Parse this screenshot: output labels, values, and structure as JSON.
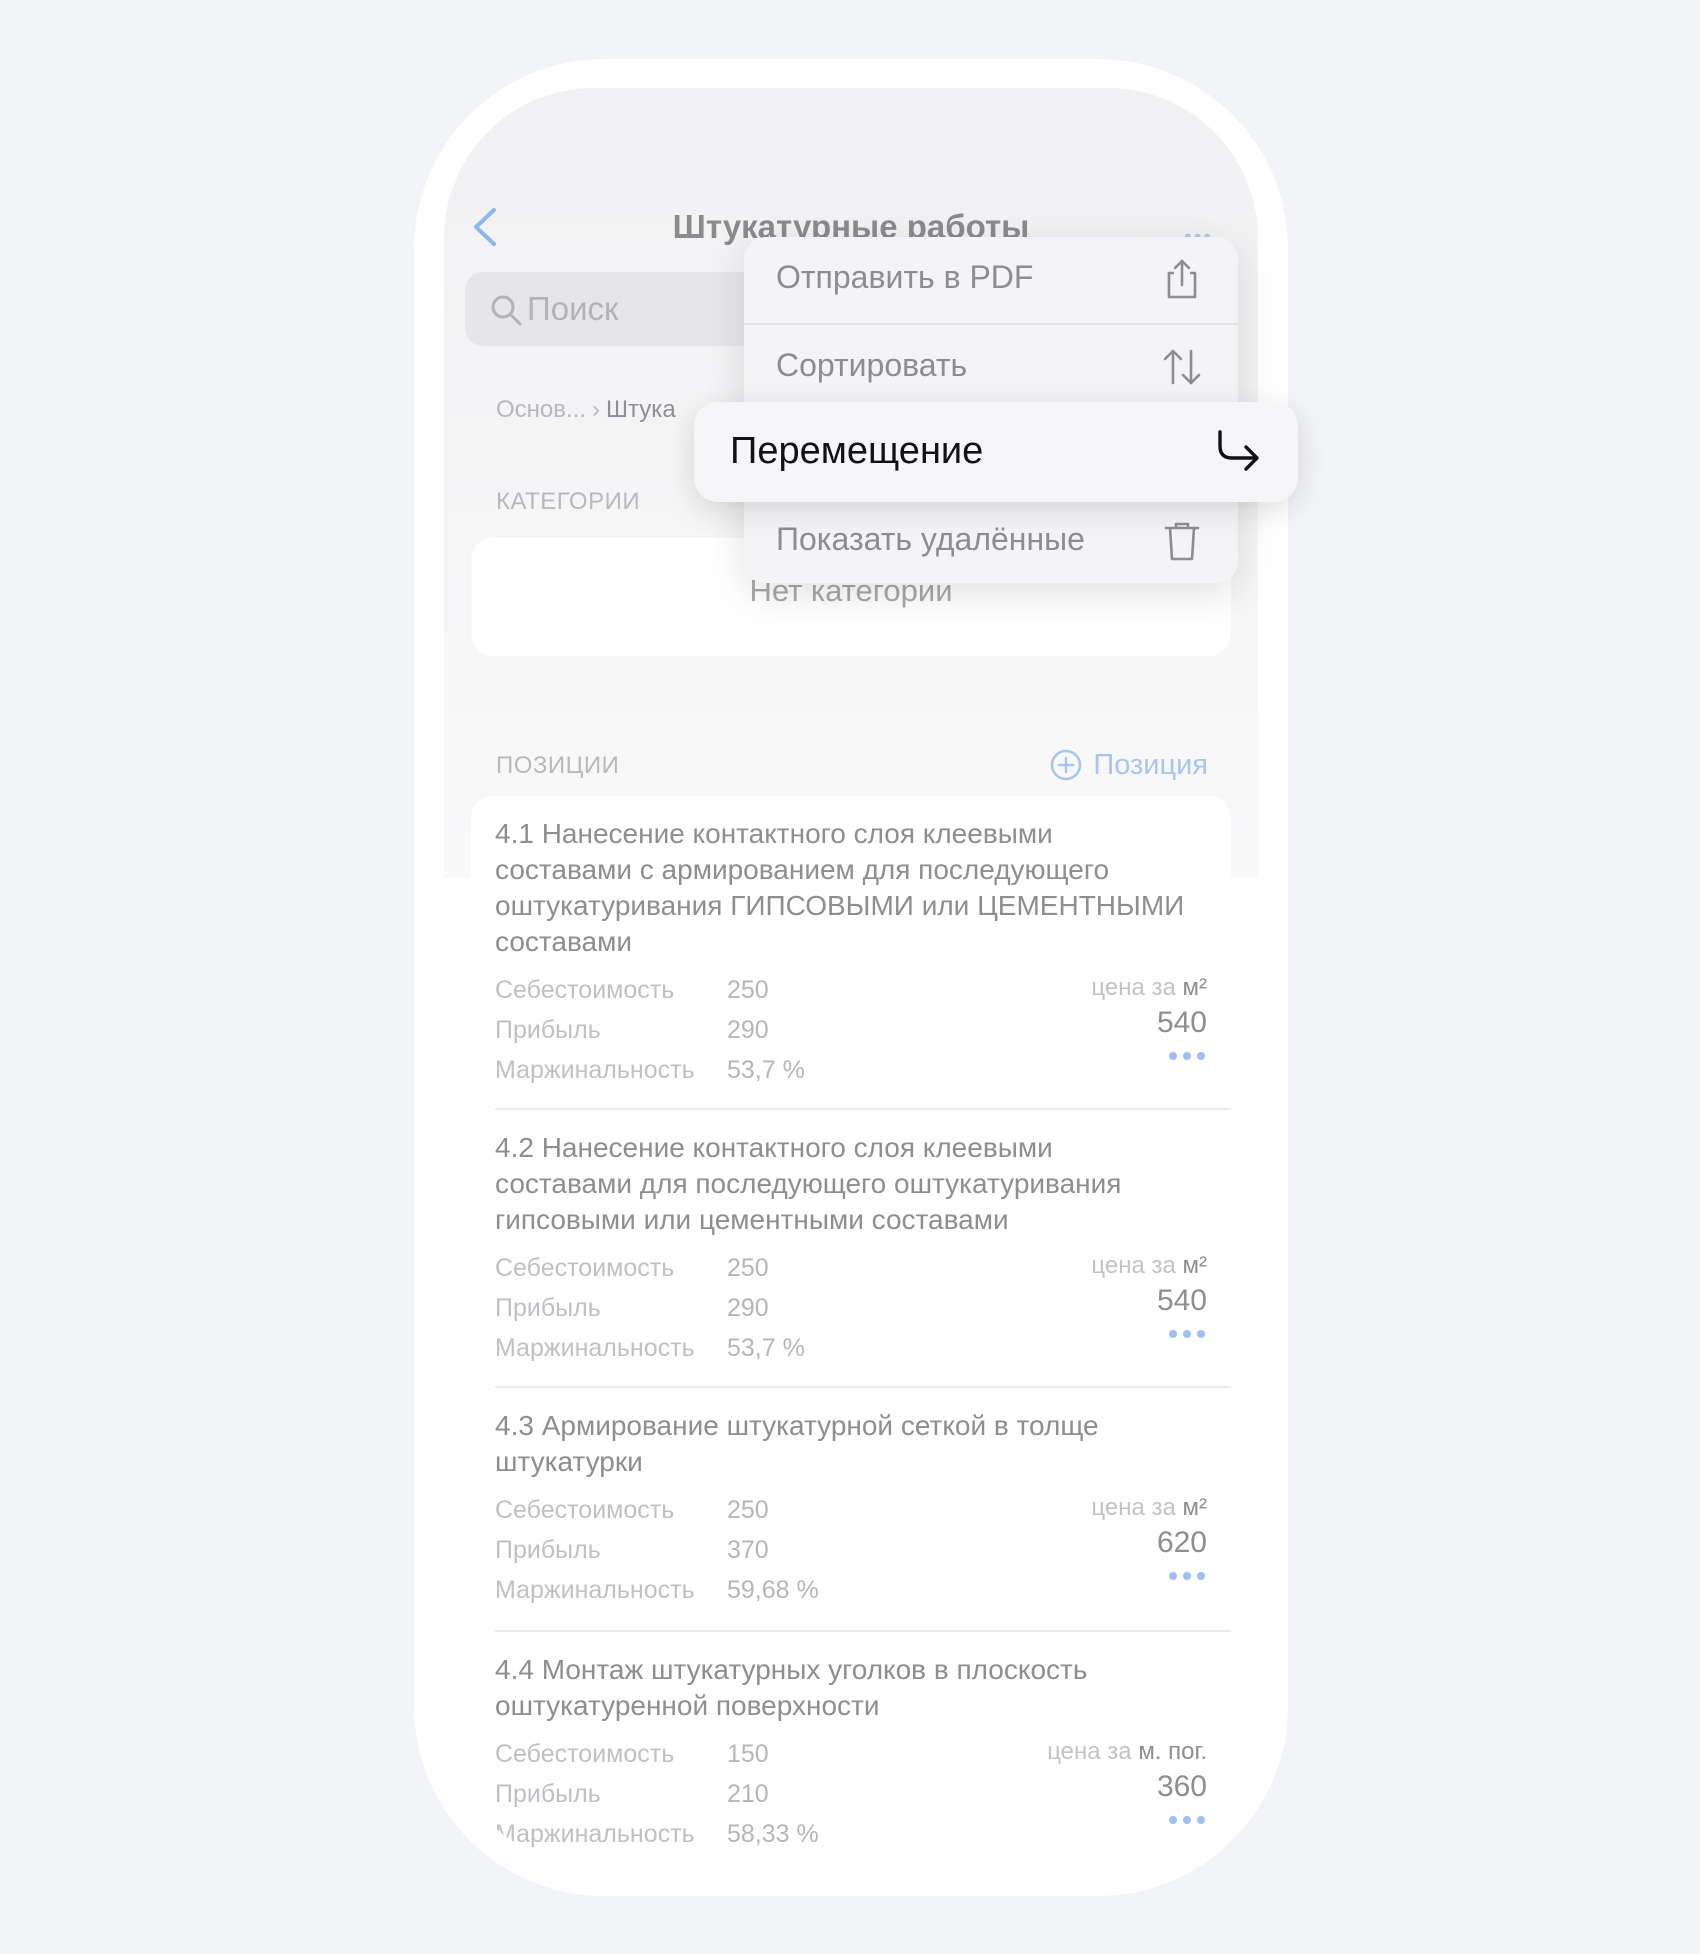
{
  "nav": {
    "title": "Штукатурные работы",
    "more": "•••"
  },
  "search": {
    "placeholder": "Поиск"
  },
  "breadcrumb": {
    "parent": "Основ...",
    "current": "Штука"
  },
  "categories": {
    "label": "КАТЕГОРИИ",
    "empty_text": "Нет категорий"
  },
  "positions": {
    "label": "ПОЗИЦИИ",
    "add_label": "Позиция",
    "items": [
      {
        "title": "4.1 Нанесение контактного слоя клеевыми составами с армированием для последующего оштукатуривания ГИПСОВЫМИ или ЦЕМЕНТНЫМИ составами",
        "cost_label": "Себестоимость",
        "cost": "250",
        "profit_label": "Прибыль",
        "profit": "290",
        "margin_label": "Маржинальность",
        "margin": "53,7 %",
        "price_prefix": "цена за",
        "unit": "м²",
        "price": "540"
      },
      {
        "title": "4.2 Нанесение контактного слоя клеевыми составами для последующего оштукатуривания гипсовыми или цементными составами",
        "cost_label": "Себестоимость",
        "cost": "250",
        "profit_label": "Прибыль",
        "profit": "290",
        "margin_label": "Маржинальность",
        "margin": "53,7 %",
        "price_prefix": "цена за",
        "unit": "м²",
        "price": "540"
      },
      {
        "title": "4.3 Армирование штукатурной сеткой в толще штукатурки",
        "cost_label": "Себестоимость",
        "cost": "250",
        "profit_label": "Прибыль",
        "profit": "370",
        "margin_label": "Маржинальность",
        "margin": "59,68 %",
        "price_prefix": "цена за",
        "unit": "м²",
        "price": "620"
      },
      {
        "title": "4.4 Монтаж штукатурных уголков в плоскость оштукатуренной поверхности",
        "cost_label": "Себестоимость",
        "cost": "150",
        "profit_label": "Прибыль",
        "profit": "210",
        "margin_label": "Маржинальность",
        "margin": "58,33 %",
        "price_prefix": "цена за",
        "unit": "м. пог.",
        "price": "360"
      }
    ]
  },
  "menu": {
    "items": [
      {
        "label": "Отправить в PDF",
        "icon": "share-icon"
      },
      {
        "label": "Сортировать",
        "icon": "sort-icon"
      },
      {
        "label": "Перемещение",
        "icon": "move-arrow-icon",
        "highlighted": true
      },
      {
        "label": "Показать удалённые",
        "icon": "trash-icon"
      }
    ]
  },
  "colors": {
    "accent": "#6fa3e8",
    "background": "#f3f4f8"
  }
}
